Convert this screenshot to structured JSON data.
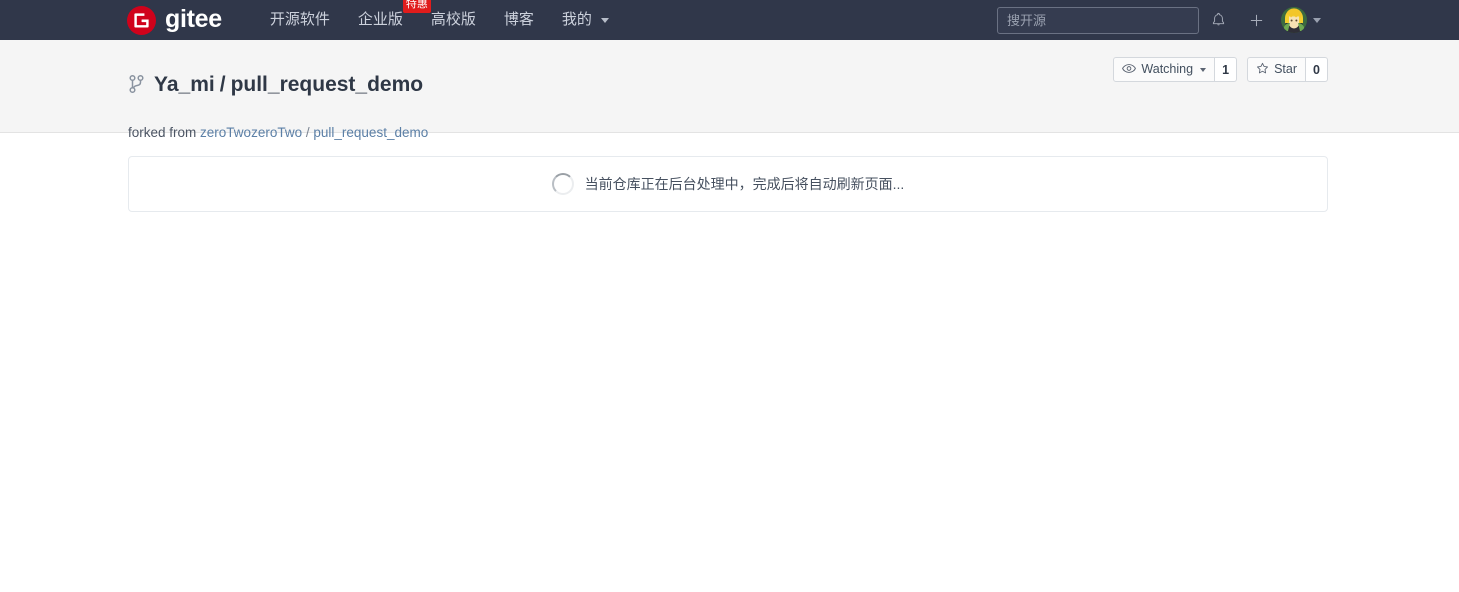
{
  "header": {
    "brand": {
      "logo_icon": "gitee-logo-icon",
      "text": "gitee"
    },
    "nav": [
      {
        "label": "开源软件",
        "badge": null
      },
      {
        "label": "企业版",
        "badge": "特惠"
      },
      {
        "label": "高校版",
        "badge": null
      },
      {
        "label": "博客",
        "badge": null
      },
      {
        "label": "我的",
        "badge": null,
        "has_caret": true
      }
    ],
    "search": {
      "placeholder": "搜开源",
      "value": ""
    },
    "icons": {
      "notifications": "bell-icon",
      "create": "plus-icon",
      "avatar": "user-avatar",
      "avatar_caret": "chevron-down-icon"
    }
  },
  "repo": {
    "icon": "fork-icon",
    "owner": "Ya_mi",
    "separator": "/",
    "name": "pull_request_demo",
    "forked_prefix": "forked from",
    "forked_owner": "zeroTwozeroTwo",
    "forked_separator": "/",
    "forked_repo": "pull_request_demo",
    "actions": {
      "watch_icon": "eye-icon",
      "watch_label": "Watching",
      "watch_count": "1",
      "star_icon": "star-icon",
      "star_label": "Star",
      "star_count": "0"
    }
  },
  "main": {
    "notice": {
      "spinner_icon": "loading-spinner-icon",
      "text": "当前仓库正在后台处理中，完成后将自动刷新页面..."
    }
  },
  "colors": {
    "header_bg": "#30374a",
    "brand_red": "#d0021b",
    "badge_red": "#e01c1c",
    "band_bg": "#f5f5f5",
    "link_blue": "#5b7fa6",
    "title_dark": "#2f3846"
  }
}
